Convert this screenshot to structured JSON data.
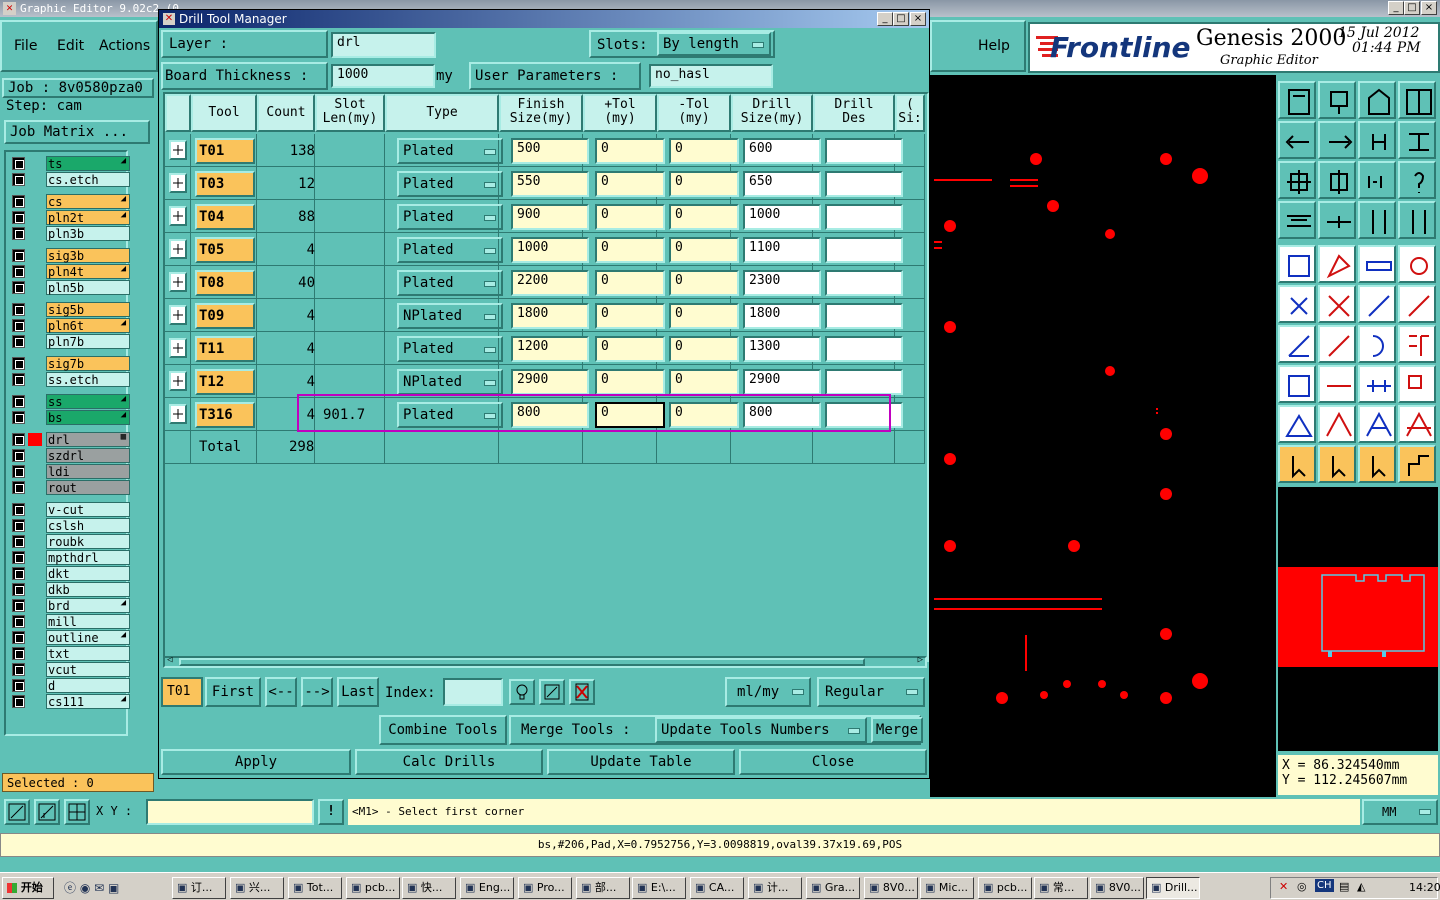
{
  "window": {
    "title": "Graphic Editor 9.02c2 (0",
    "min": "_",
    "max": "□",
    "close": "×"
  },
  "menu": {
    "file": "File",
    "edit": "Edit",
    "actions": "Actions",
    "help": "Help"
  },
  "brand": {
    "logo": "Frontline",
    "product": "Genesis 2000",
    "subtitle": "Graphic Editor",
    "date": "15 Jul 2012",
    "time": "01:44 PM"
  },
  "job": {
    "job_label": "Job : 8v0580pza0",
    "step_label": "Step: cam",
    "matrix_button": "Job Matrix ..."
  },
  "layers": [
    {
      "name": "ts",
      "color": "#1aa86a",
      "mark": "◢",
      "group": 0
    },
    {
      "name": "cs.etch",
      "color": "#c6f2ec",
      "mark": "",
      "group": 0
    },
    {
      "name": "cs",
      "color": "#fac35b",
      "mark": "◢",
      "group": 1
    },
    {
      "name": "pln2t",
      "color": "#fac35b",
      "mark": "◢",
      "group": 1
    },
    {
      "name": "pln3b",
      "color": "#c6f2ec",
      "mark": "",
      "group": 1
    },
    {
      "name": "sig3b",
      "color": "#fac35b",
      "mark": "",
      "group": 2
    },
    {
      "name": "pln4t",
      "color": "#fac35b",
      "mark": "◢",
      "group": 2
    },
    {
      "name": "pln5b",
      "color": "#c6f2ec",
      "mark": "",
      "group": 2
    },
    {
      "name": "sig5b",
      "color": "#fac35b",
      "mark": "",
      "group": 3
    },
    {
      "name": "pln6t",
      "color": "#fac35b",
      "mark": "◢",
      "group": 3
    },
    {
      "name": "pln7b",
      "color": "#c6f2ec",
      "mark": "",
      "group": 3
    },
    {
      "name": "sig7b",
      "color": "#fac35b",
      "mark": "",
      "group": 4
    },
    {
      "name": "ss.etch",
      "color": "#c6f2ec",
      "mark": "",
      "group": 4
    },
    {
      "name": "ss",
      "color": "#1aa86a",
      "mark": "◢",
      "group": 5
    },
    {
      "name": "bs",
      "color": "#1aa86a",
      "mark": "◢",
      "group": 5
    },
    {
      "name": "drl",
      "color": "#9aa0a0",
      "mark": "▦",
      "group": 6
    },
    {
      "name": "szdrl",
      "color": "#9aa0a0",
      "mark": "",
      "group": 6
    },
    {
      "name": "ldi",
      "color": "#9aa0a0",
      "mark": "",
      "group": 6
    },
    {
      "name": "rout",
      "color": "#9aa0a0",
      "mark": "",
      "group": 6
    },
    {
      "name": "v-cut",
      "color": "#c6f2ec",
      "mark": "",
      "group": 7
    },
    {
      "name": "cslsh",
      "color": "#c6f2ec",
      "mark": "",
      "group": 7
    },
    {
      "name": "roubk",
      "color": "#c6f2ec",
      "mark": "",
      "group": 7
    },
    {
      "name": "mpthdrl",
      "color": "#c6f2ec",
      "mark": "",
      "group": 7
    },
    {
      "name": "dkt",
      "color": "#c6f2ec",
      "mark": "",
      "group": 7
    },
    {
      "name": "dkb",
      "color": "#c6f2ec",
      "mark": "",
      "group": 7
    },
    {
      "name": "brd",
      "color": "#c6f2ec",
      "mark": "◢",
      "group": 7
    },
    {
      "name": "mill",
      "color": "#c6f2ec",
      "mark": "",
      "group": 7
    },
    {
      "name": "outline",
      "color": "#c6f2ec",
      "mark": "◢",
      "group": 7
    },
    {
      "name": "txt",
      "color": "#c6f2ec",
      "mark": "",
      "group": 7
    },
    {
      "name": "vcut",
      "color": "#c6f2ec",
      "mark": "",
      "group": 7
    },
    {
      "name": "d",
      "color": "#c6f2ec",
      "mark": "",
      "group": 7
    },
    {
      "name": "cs111",
      "color": "#c6f2ec",
      "mark": "◢",
      "group": 7
    }
  ],
  "selected": "Selected : 0",
  "dialog": {
    "title": "Drill Tool Manager",
    "layer_label": "Layer          :",
    "layer_value": "drl",
    "slots_label": "Slots:",
    "slots_value": "By length",
    "board_thickness_label": "Board Thickness  :",
    "board_thickness_value": "1000",
    "board_thickness_unit": "my",
    "user_params_label": "User Parameters  :",
    "user_params_value": "no_hasl",
    "columns": [
      "Tool",
      "Count",
      "Slot\nLen(my)",
      "Type",
      "Finish\nSize(my)",
      "+Tol\n(my)",
      "-Tol\n(my)",
      "Drill\nSize(my)",
      "Drill\nDes",
      "("
    ],
    "col_tool": "Tool",
    "col_count": "Count",
    "col_slot1": "Slot",
    "col_slot2": "Len(my)",
    "col_type": "Type",
    "col_finish1": "Finish",
    "col_finish2": "Size(my)",
    "col_ptol1": "+Tol",
    "col_ptol2": "(my)",
    "col_ntol1": "-Tol",
    "col_ntol2": "(my)",
    "col_drill1": "Drill",
    "col_drill2": "Size(my)",
    "col_des1": "Drill",
    "col_des2": "Des",
    "col_extra1": "(",
    "col_extra2": "Si:",
    "rows": [
      {
        "tool": "T01",
        "count": "138",
        "slot": "",
        "type": "Plated",
        "finish": "500",
        "ptol": "0",
        "ntol": "0",
        "drill": "600",
        "des": "",
        "active": true
      },
      {
        "tool": "T03",
        "count": "12",
        "slot": "",
        "type": "Plated",
        "finish": "550",
        "ptol": "0",
        "ntol": "0",
        "drill": "650",
        "des": "",
        "active": false
      },
      {
        "tool": "T04",
        "count": "88",
        "slot": "",
        "type": "Plated",
        "finish": "900",
        "ptol": "0",
        "ntol": "0",
        "drill": "1000",
        "des": "",
        "active": false
      },
      {
        "tool": "T05",
        "count": "4",
        "slot": "",
        "type": "Plated",
        "finish": "1000",
        "ptol": "0",
        "ntol": "0",
        "drill": "1100",
        "des": "",
        "active": false
      },
      {
        "tool": "T08",
        "count": "40",
        "slot": "",
        "type": "Plated",
        "finish": "2200",
        "ptol": "0",
        "ntol": "0",
        "drill": "2300",
        "des": "",
        "active": false
      },
      {
        "tool": "T09",
        "count": "4",
        "slot": "",
        "type": "NPlated",
        "finish": "1800",
        "ptol": "0",
        "ntol": "0",
        "drill": "1800",
        "des": "",
        "active": false
      },
      {
        "tool": "T11",
        "count": "4",
        "slot": "",
        "type": "Plated",
        "finish": "1200",
        "ptol": "0",
        "ntol": "0",
        "drill": "1300",
        "des": "",
        "active": false
      },
      {
        "tool": "T12",
        "count": "4",
        "slot": "",
        "type": "NPlated",
        "finish": "2900",
        "ptol": "0",
        "ntol": "0",
        "drill": "2900",
        "des": "",
        "active": false
      },
      {
        "tool": "T316",
        "count": "4",
        "slot": "901.7",
        "type": "Plated",
        "finish": "800",
        "ptol": "0",
        "ntol": "0",
        "drill": "800",
        "des": "",
        "active": false
      }
    ],
    "total_label": "Total",
    "total_value": "298",
    "nav": {
      "current": "T01",
      "first": "First",
      "prev": "<--",
      "next": "-->",
      "last": "Last",
      "index_label": "Index:",
      "units": "ml/my",
      "mode": "Regular"
    },
    "buttons": {
      "combine": "Combine Tools",
      "merge_label": "Merge Tools  :",
      "merge_option": "Update Tools Numbers",
      "merge": "Merge",
      "apply": "Apply",
      "calc": "Calc Drills",
      "update": "Update Table",
      "close": "Close"
    }
  },
  "coords": {
    "x": "X  =  86.324540mm",
    "y": "Y  =  112.245607mm"
  },
  "command": {
    "xy_label": "X Y :",
    "prompt": "<M1> - Select first corner",
    "units": "MM"
  },
  "status_line": "bs,#206,Pad,X=0.7952756,Y=3.0098819,oval39.37x19.69,POS",
  "taskbar": {
    "start": "开始",
    "tasks": [
      "订...",
      "兴...",
      "Tot...",
      "pcb...",
      "快...",
      "Eng...",
      "Pro...",
      "部...",
      "E:\\...",
      "CA...",
      "计...",
      "Gra...",
      "8V0...",
      "Mic...",
      "pcb...",
      "常...",
      "8V0...",
      "Drill..."
    ],
    "clock": "14:20",
    "lang": "CH"
  },
  "colors": {
    "panel": "#5fc1b6",
    "orange": "#fac35b",
    "red": "#ff0000",
    "highlight": "#c000c0"
  }
}
